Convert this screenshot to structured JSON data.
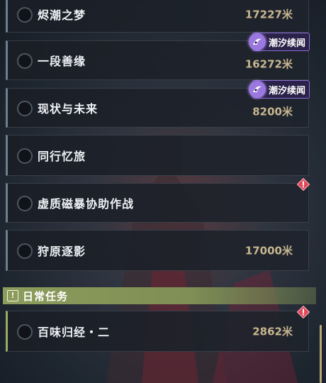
{
  "quests": [
    {
      "name": "烬潮之梦",
      "distance": "17227米"
    },
    {
      "name": "一段善缘",
      "distance": "16272米",
      "tag": "潮汐续闻"
    },
    {
      "name": "现状与未来",
      "distance": "8200米",
      "tag": "潮汐续闻"
    },
    {
      "name": "同行忆旅",
      "distance": ""
    },
    {
      "name": "虚质磁暴协助作战",
      "distance": "",
      "alert": true
    },
    {
      "name": "狩原逐影",
      "distance": "17000米"
    }
  ],
  "daily_section": {
    "title": "日常任务",
    "icon": "exclamation-icon",
    "quests": [
      {
        "name": "百味归经・二",
        "distance": "2862米",
        "alert": true
      }
    ]
  },
  "colors": {
    "daily_accent": "#9aab66",
    "distance_text": "#c8b690",
    "tag_bg": "#2a2248",
    "tag_icon": "#9a78e0",
    "alert": "#e0485a"
  }
}
